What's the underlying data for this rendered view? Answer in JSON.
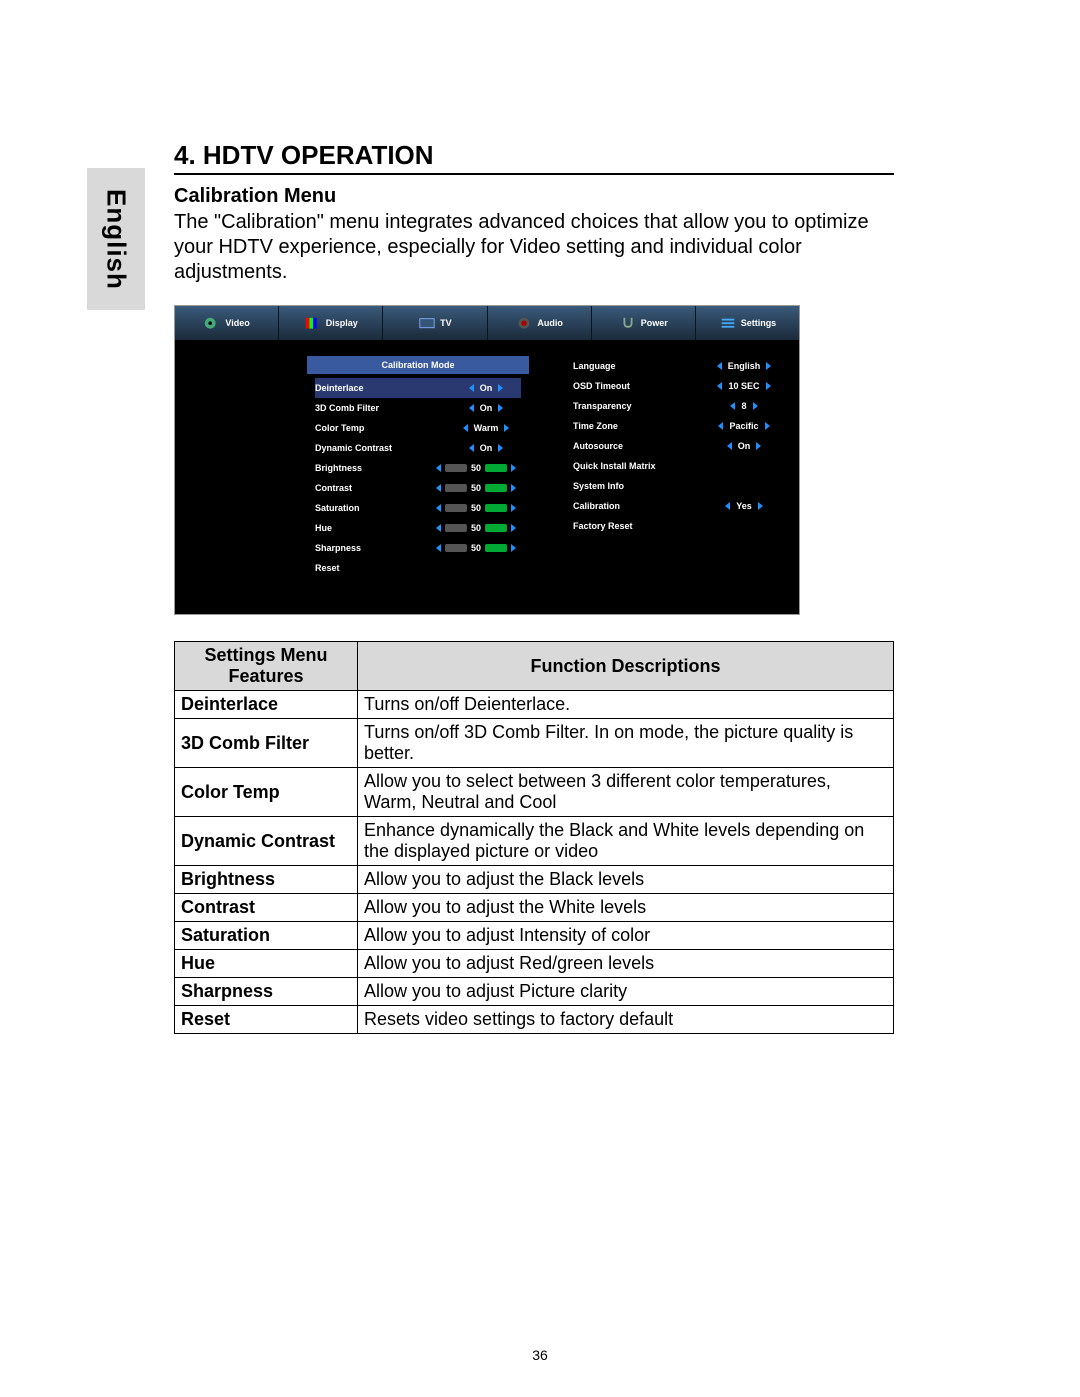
{
  "language_tab": "English",
  "section_title": "4.    HDTV OPERATION",
  "sub_title": "Calibration Menu",
  "intro": "The \"Calibration\" menu integrates advanced  choices that allow you to optimize your HDTV experience, especially for Video setting and individual color adjustments.",
  "osd": {
    "tabs": [
      "Video",
      "Display",
      "TV",
      "Audio",
      "Power",
      "Settings"
    ],
    "calibration_header": "Calibration Mode",
    "left_rows": [
      {
        "label": "Deinterlace",
        "value": "On",
        "type": "arrows",
        "selected": true
      },
      {
        "label": "3D Comb Filter",
        "value": "On",
        "type": "arrows"
      },
      {
        "label": "Color Temp",
        "value": "Warm",
        "type": "arrows"
      },
      {
        "label": "Dynamic Contrast",
        "value": "On",
        "type": "arrows"
      },
      {
        "label": "Brightness",
        "value": "50",
        "type": "slider"
      },
      {
        "label": "Contrast",
        "value": "50",
        "type": "slider"
      },
      {
        "label": "Saturation",
        "value": "50",
        "type": "slider"
      },
      {
        "label": "Hue",
        "value": "50",
        "type": "slider"
      },
      {
        "label": "Sharpness",
        "value": "50",
        "type": "slider"
      },
      {
        "label": "Reset",
        "value": "",
        "type": "none"
      }
    ],
    "right_rows": [
      {
        "label": "Language",
        "value": "English",
        "type": "arrows"
      },
      {
        "label": "OSD Timeout",
        "value": "10 SEC",
        "type": "arrows"
      },
      {
        "label": "Transparency",
        "value": "8",
        "type": "arrows"
      },
      {
        "label": "Time Zone",
        "value": "Pacific",
        "type": "arrows"
      },
      {
        "label": "Autosource",
        "value": "On",
        "type": "arrows"
      },
      {
        "label": "Quick Install Matrix",
        "value": "",
        "type": "none"
      },
      {
        "label": "System Info",
        "value": "",
        "type": "none"
      },
      {
        "label": "Calibration",
        "value": "Yes",
        "type": "arrows"
      },
      {
        "label": "Factory Reset",
        "value": "",
        "type": "none"
      }
    ]
  },
  "table": {
    "header_feature": "Settings Menu Features",
    "header_desc": "Function Descriptions",
    "rows": [
      {
        "feature": "Deinterlace",
        "desc": "Turns on/off Deienterlace."
      },
      {
        "feature": "3D Comb Filter",
        "desc": "Turns on/off 3D Comb Filter. In on mode, the picture quality is better."
      },
      {
        "feature": "Color Temp",
        "desc": "Allow you to select between 3 different color temperatures, Warm, Neutral and Cool"
      },
      {
        "feature": "Dynamic Contrast",
        "desc": "Enhance dynamically the Black and White levels depending on the displayed picture or video"
      },
      {
        "feature": "Brightness",
        "desc": "Allow you to adjust the Black levels"
      },
      {
        "feature": "Contrast",
        "desc": "Allow you to adjust the White levels"
      },
      {
        "feature": "Saturation",
        "desc": "Allow you to adjust Intensity of color"
      },
      {
        "feature": "Hue",
        "desc": "Allow you to  adjust  Red/green levels"
      },
      {
        "feature": "Sharpness",
        "desc": "Allow you to  adjust  Picture clarity"
      },
      {
        "feature": "Reset",
        "desc": "Resets video settings to factory default"
      }
    ]
  },
  "page_number": "36"
}
